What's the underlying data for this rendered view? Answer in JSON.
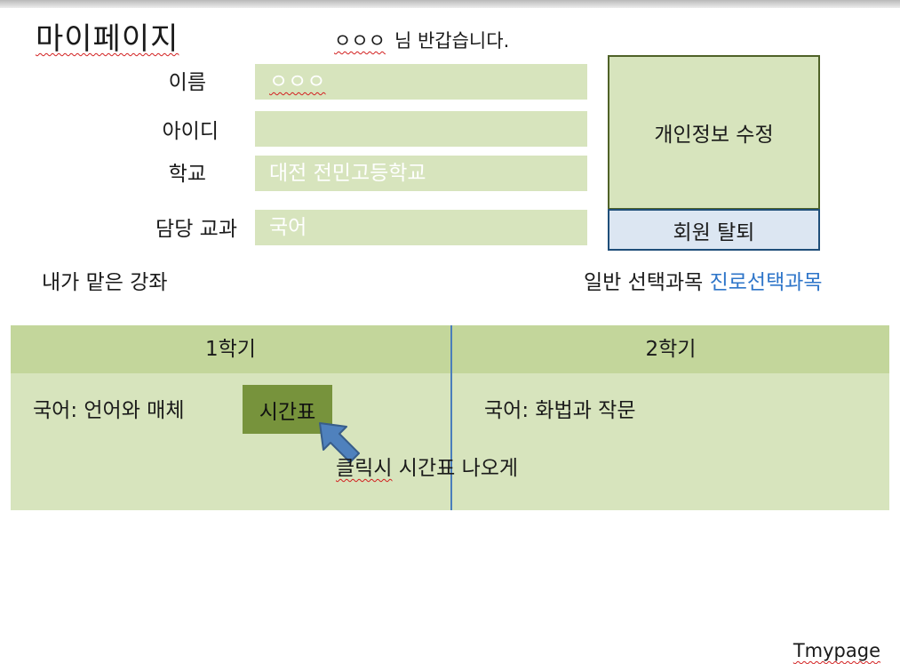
{
  "header": {
    "title": "마이페이지",
    "greeting_name": "ㅇㅇㅇ",
    "greeting_text": "님 반갑습니다."
  },
  "profile": {
    "name_label": "이름",
    "name_value": "ㅇㅇㅇ",
    "id_label": "아이디",
    "id_value": "",
    "school_label": "학교",
    "school_value": "대전 전민고등학교",
    "subject_label": "담당 교과",
    "subject_value": "국어"
  },
  "actions": {
    "edit_profile_label": "개인정보 수정",
    "withdraw_label": "회원 탈퇴"
  },
  "courses": {
    "my_courses_label": "내가 맡은 강좌",
    "filter_general": "일반 선택과목",
    "filter_career": "진로선택과목",
    "semester1_title": "1학기",
    "semester2_title": "2학기",
    "semester1_course": "국어: 언어와 매체",
    "semester2_course": "국어: 화법과 작문",
    "timetable_button": "시간표",
    "note_prefix": "클릭시",
    "note_rest": "시간표 나오게"
  },
  "footer": {
    "label": "Tmypage"
  },
  "colors": {
    "field_bg": "#d7e4bd",
    "table_head": "#c3d69b",
    "button_green": "#77933c",
    "withdraw_bg": "#dce6f2",
    "link_blue": "#2e75c9",
    "arrow_blue": "#4f81bd"
  },
  "icons": {
    "arrow": "arrow-pointer-icon"
  }
}
